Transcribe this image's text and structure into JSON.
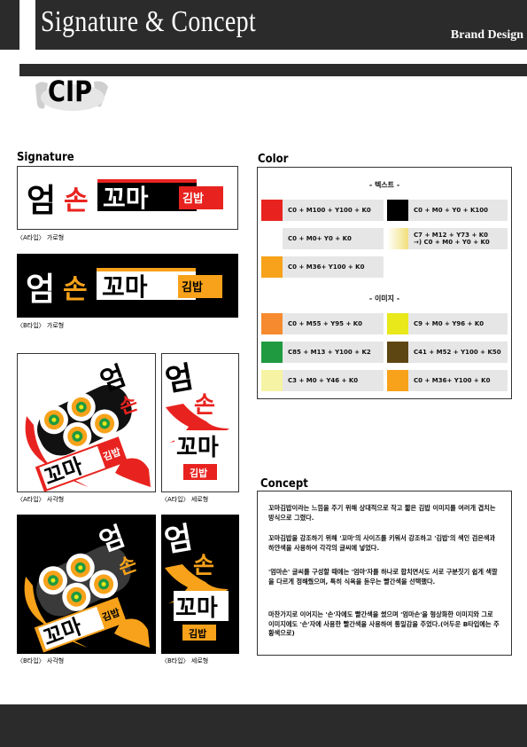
{
  "header": {
    "title": "Signature & Concept",
    "subtitle": "Brand Design"
  },
  "section_label": "CIP",
  "signature": {
    "title": "Signature",
    "logo_text": {
      "eom": "엄",
      "son": "손",
      "kkoma": "꼬마",
      "gimbap": "김밥"
    },
    "captions": {
      "a_horizontal": "〈A타입〉 가로형",
      "b_horizontal": "〈B타입〉 가로형",
      "a_square": "〈A타입〉 사각형",
      "a_vertical": "〈A타입〉 세로형",
      "b_square": "〈B타입〉 사각형",
      "b_vertical": "〈B타입〉 세로형"
    }
  },
  "color": {
    "title": "Color",
    "text_group": "- 텍스트 -",
    "image_group": "- 이미지 -",
    "text_colors": [
      {
        "label": "C0 + M100 + Y100 + K0",
        "hex": "#e8231f"
      },
      {
        "label": "C0 + M0 + Y0 + K100",
        "hex": "#000000"
      },
      {
        "label": "C0 + M0+ Y0 + K0",
        "hex": "#ffffff"
      },
      {
        "label": "C7 + M12 + Y73 + K0",
        "label2": "→) C0 + M0 + Y0 + K0",
        "hex": "#f2df7a"
      },
      {
        "label": "C0 + M36+ Y100 + K0",
        "hex": "#f7a21a"
      }
    ],
    "image_colors": [
      {
        "label": "C0 + M55 + Y95 + K0",
        "hex": "#f58b2e"
      },
      {
        "label": "C9 + M0 + Y96 + K0",
        "hex": "#e8e81a"
      },
      {
        "label": "C85 + M13 + Y100 + K2",
        "hex": "#1f9a40"
      },
      {
        "label": "C41 + M52 + Y100 + K50",
        "hex": "#5e4613"
      },
      {
        "label": "C3 + M0 + Y46 + K0",
        "hex": "#f6f3a4"
      },
      {
        "label": "C0 + M36+ Y100 + K0",
        "hex": "#f7a21a"
      }
    ]
  },
  "concept": {
    "title": "Concept",
    "paragraphs": [
      "꼬마김밥이라는 느낌을 주기 위해 상대적으로 작고 짧은 김밥 이미지를 여러개 겹치는 방식으로 그렸다.",
      "꼬마김밥을 강조하기 위해 '꼬마'의 사이즈를 키워서 강조하고 '김밥'의 색인 검은색과 하얀색을 사용하여 각각의 글씨에 넣었다.",
      "'엄마손' 글씨를 구성할 때에는 '엄마'자를 하나로 합치면서도 서로 구분짓기 쉽게 색깔을 다르게 정해줬으며, 특히 식욕을 돋우는 빨간색을 선택했다.",
      "마찬가지로 이어지는 '손'자에도 빨간색을 썼으며 '엄마손'을 형상화한 이미지와 그로 이미지에도 '손'자에 사용한 빨간색을 사용하여 통일감을 주었다.(어두운 B타입에는 주황색으로)"
    ]
  }
}
